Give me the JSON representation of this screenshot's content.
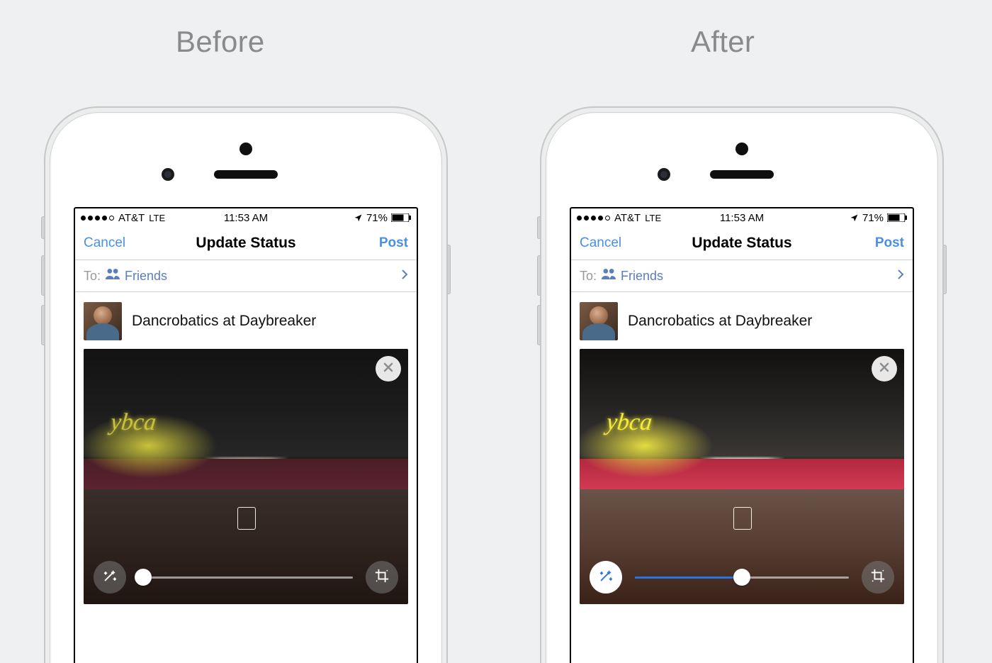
{
  "labels": {
    "before": "Before",
    "after": "After"
  },
  "statusbar": {
    "carrier": "AT&T",
    "network": "LTE",
    "time": "11:53 AM",
    "battery_pct": "71%"
  },
  "navbar": {
    "cancel": "Cancel",
    "title": "Update Status",
    "post": "Post"
  },
  "recipient": {
    "to_label": "To:",
    "selector": "Friends"
  },
  "composer": {
    "status_text": "Dancrobatics at Daybreaker"
  },
  "photo": {
    "venue_sign": "ybca",
    "before": {
      "magic_active": false,
      "slider_pct": 2
    },
    "after": {
      "magic_active": true,
      "slider_pct": 50
    }
  }
}
